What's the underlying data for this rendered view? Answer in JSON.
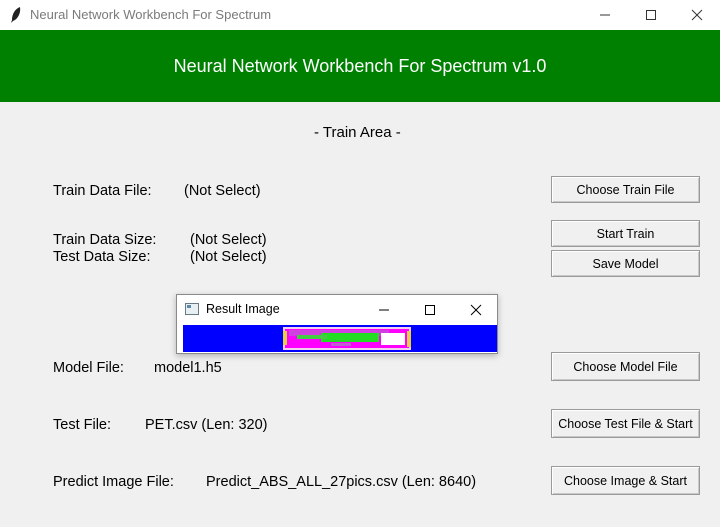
{
  "window": {
    "title": "Neural Network Workbench For Spectrum"
  },
  "header": {
    "title": "Neural Network Workbench For Spectrum v1.0"
  },
  "train_area": {
    "section_label": "- Train Area -",
    "train_data_file_label": "Train Data File:",
    "train_data_file_value": "(Not Select)",
    "choose_train_file_button": "Choose Train File",
    "train_data_size_label": "Train Data Size:",
    "train_data_size_value": "(Not Select)",
    "test_data_size_label": "Test Data Size:",
    "test_data_size_value": "(Not Select)",
    "start_train_button": "Start Train",
    "save_model_button": "Save Model"
  },
  "result_popup": {
    "title": "Result Image"
  },
  "model": {
    "model_file_label": "Model File:",
    "model_file_value": "model1.h5",
    "choose_model_file_button": "Choose Model File"
  },
  "test": {
    "test_file_label": "Test File:",
    "test_file_value": "PET.csv (Len: 320)",
    "choose_test_file_button": "Choose Test File & Start"
  },
  "predict": {
    "predict_image_file_label": "Predict Image File:",
    "predict_image_file_value": "Predict_ABS_ALL_27pics.csv (Len: 8640)",
    "choose_image_button": "Choose Image & Start"
  },
  "colors": {
    "header_bg": "#008000",
    "result_bg": "#0000ff"
  }
}
